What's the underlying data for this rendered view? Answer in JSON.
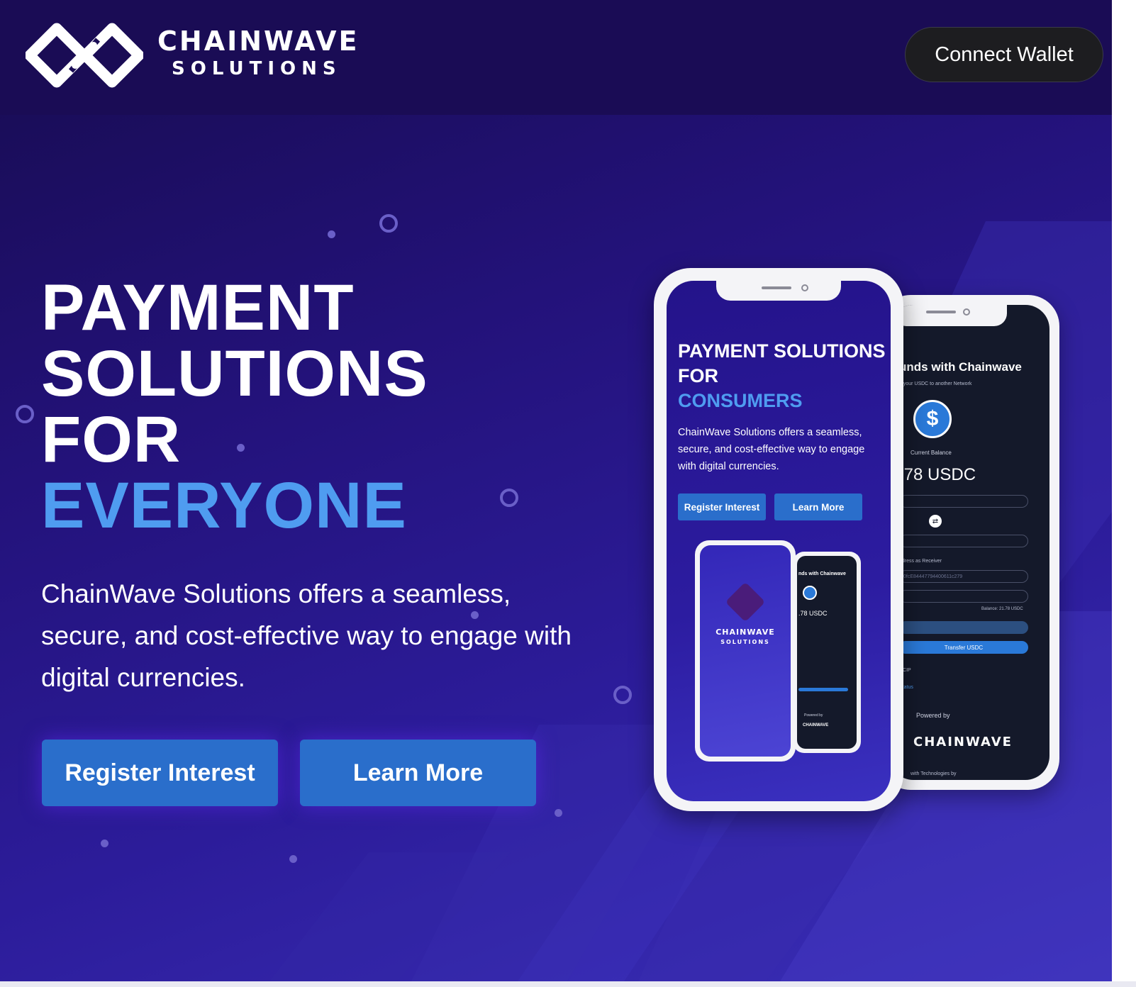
{
  "header": {
    "logo_title": "CHAINWAVE",
    "logo_subtitle": "SOLUTIONS",
    "connect_wallet_label": "Connect Wallet"
  },
  "hero": {
    "title_line1": "PAYMENT",
    "title_line2": "SOLUTIONS",
    "title_line3": "FOR",
    "title_accent": "EVERYONE",
    "description": "ChainWave Solutions offers a seamless, secure, and cost-effective way to engage with digital currencies.",
    "register_label": "Register Interest",
    "learn_label": "Learn More"
  },
  "phone_front": {
    "title_line1": "PAYMENT SOLUTIONS",
    "title_line2": "FOR",
    "title_accent": "CONSUMERS",
    "description": "ChainWave Solutions offers a seamless, secure, and cost-effective way to engage with digital currencies.",
    "register_label": "Register Interest",
    "learn_label": "Learn More",
    "mini_brand_title": "CHAINWAVE",
    "mini_brand_sub": "SOLUTIONS",
    "mini_heading": "nds with Chainwave",
    "mini_balance": ".78 USDC",
    "mini_powered": "Powered by",
    "mini_brand_back": "CHAINWAVE"
  },
  "phone_back": {
    "heading": "unds with Chainwave",
    "subheading": "g your USDC to another Network",
    "balance_label": "Current Balance",
    "balance_value": ".78 USDC",
    "receiver_label": "ddress as Receiver",
    "receiver_value": "0fcE84447794400611c279",
    "balance_hint": "Balance: 21.78 USDC",
    "transfer_label": "Transfer USDC",
    "ccip_label": "CCIP",
    "status_label": "Status",
    "powered_label": "Powered by",
    "brand": "CHAINWAVE",
    "tech_label": "with Technologies by"
  },
  "colors": {
    "accent_blue": "#4f9cf0",
    "button_blue": "#2a6ecb",
    "header_bg": "#1a0c55"
  }
}
